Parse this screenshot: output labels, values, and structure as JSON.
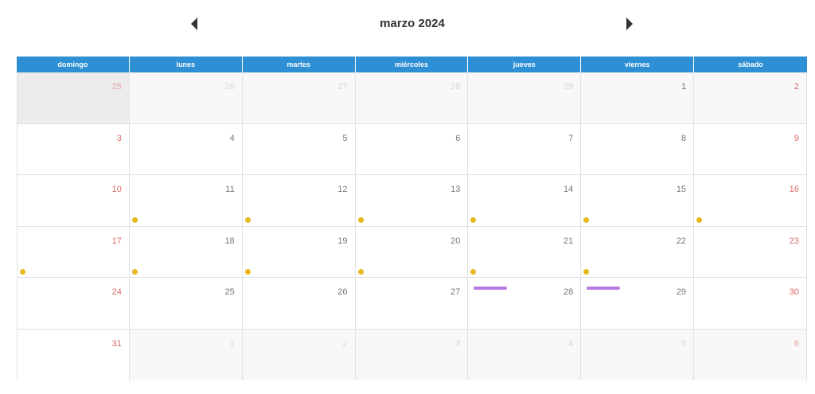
{
  "header": {
    "title": "marzo 2024",
    "prev_icon": "caret-left-icon",
    "next_icon": "caret-right-icon"
  },
  "colors": {
    "header_bg": "#2e8fd4",
    "event_dot": "#e6b81e",
    "event_bar": "#b77be0",
    "weekend_text": "#d96a6a"
  },
  "weekdays": [
    "domingo",
    "lunes",
    "martes",
    "miércoles",
    "jueves",
    "viernes",
    "sábado"
  ],
  "weeks": [
    [
      {
        "n": "25",
        "other": true,
        "shade": true
      },
      {
        "n": "26",
        "other": true
      },
      {
        "n": "27",
        "other": true
      },
      {
        "n": "28",
        "other": true
      },
      {
        "n": "29",
        "other": true
      },
      {
        "n": "1",
        "other": true,
        "faint_current": true
      },
      {
        "n": "2",
        "other": true,
        "faint_current": true
      }
    ],
    [
      {
        "n": "3"
      },
      {
        "n": "4"
      },
      {
        "n": "5"
      },
      {
        "n": "6"
      },
      {
        "n": "7"
      },
      {
        "n": "8"
      },
      {
        "n": "9"
      }
    ],
    [
      {
        "n": "10"
      },
      {
        "n": "11",
        "dot": true
      },
      {
        "n": "12",
        "dot": true
      },
      {
        "n": "13",
        "dot": true
      },
      {
        "n": "14",
        "dot": true
      },
      {
        "n": "15",
        "dot": true
      },
      {
        "n": "16",
        "dot": true
      }
    ],
    [
      {
        "n": "17",
        "dot": true
      },
      {
        "n": "18",
        "dot": true
      },
      {
        "n": "19",
        "dot": true
      },
      {
        "n": "20",
        "dot": true
      },
      {
        "n": "21",
        "dot": true
      },
      {
        "n": "22",
        "dot": true
      },
      {
        "n": "23"
      }
    ],
    [
      {
        "n": "24"
      },
      {
        "n": "25"
      },
      {
        "n": "26"
      },
      {
        "n": "27"
      },
      {
        "n": "28",
        "bar": true
      },
      {
        "n": "29",
        "bar": true
      },
      {
        "n": "30"
      }
    ],
    [
      {
        "n": "31"
      },
      {
        "n": "1",
        "other": true,
        "next": true
      },
      {
        "n": "2",
        "other": true,
        "next": true
      },
      {
        "n": "3",
        "other": true,
        "next": true
      },
      {
        "n": "4",
        "other": true,
        "next": true
      },
      {
        "n": "5",
        "other": true,
        "next": true
      },
      {
        "n": "6",
        "other": true,
        "next": true
      }
    ]
  ]
}
